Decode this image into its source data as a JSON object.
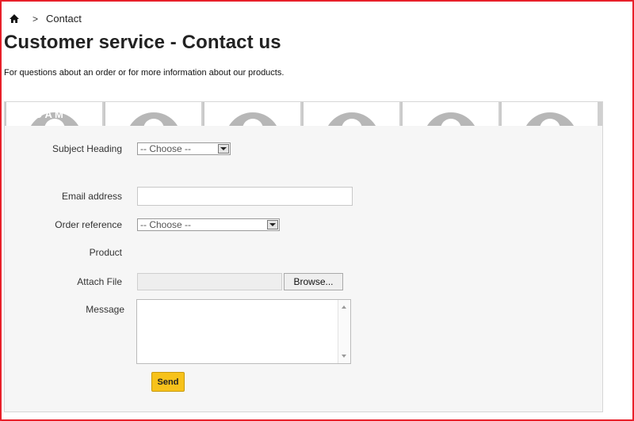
{
  "breadcrumb": {
    "separator": ">",
    "current": "Contact"
  },
  "page": {
    "title": "Customer service - Contact us",
    "intro": "For questions about an order or for more information about our products."
  },
  "banner": {
    "text": "D A M"
  },
  "form": {
    "subject": {
      "label": "Subject Heading",
      "value": "-- Choose --"
    },
    "email": {
      "label": "Email address",
      "value": ""
    },
    "order": {
      "label": "Order reference",
      "value": "-- Choose --"
    },
    "product": {
      "label": "Product"
    },
    "attach": {
      "label": "Attach File",
      "browse_label": "Browse..."
    },
    "message": {
      "label": "Message",
      "value": ""
    },
    "send_label": "Send"
  },
  "colors": {
    "accent": "#f7c21b",
    "frame": "#e8202a"
  }
}
